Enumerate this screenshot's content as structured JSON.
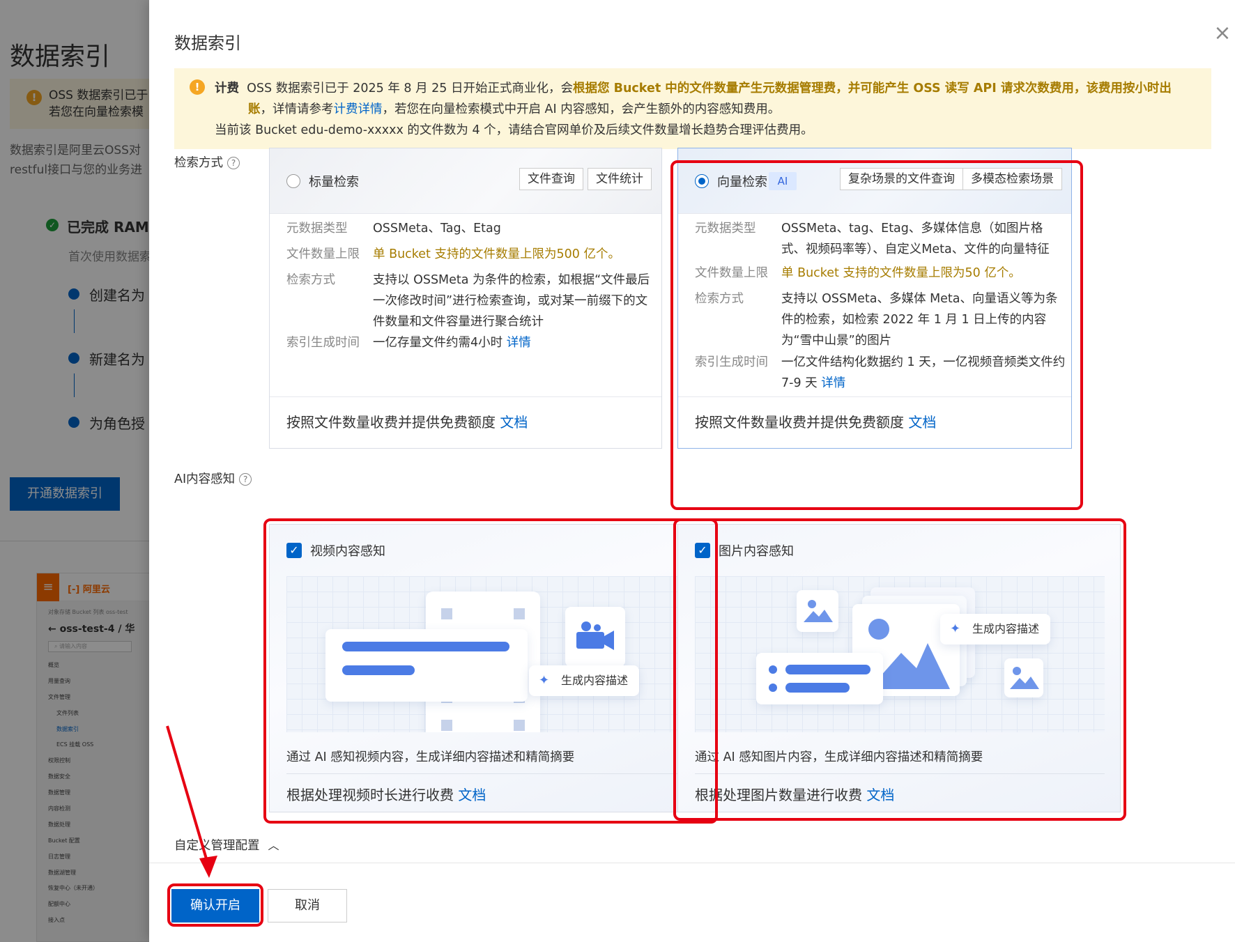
{
  "background": {
    "title": "数据索引",
    "notice_line1": "OSS 数据索引已于",
    "notice_line2": "若您在向量检索模",
    "desc_line1": "数据索引是阿里云OSS对",
    "desc_line2": "restful接口与您的业务进",
    "step_done": "已完成 RAM",
    "step_done_sub": "首次使用数据索",
    "step1": "创建名为",
    "step2": "新建名为",
    "step3": "为角色授",
    "enable_button": "开通数据索引",
    "console": {
      "logo": "阿里云",
      "breadcrumb": "对象存储   Bucket 列表   oss-test",
      "bucket_name": "oss-test-4 / 华",
      "search_placeholder": "请输入内容",
      "nav": [
        "概览",
        "用量查询",
        "文件管理",
        "文件列表",
        "数据索引",
        "ECS 挂载 OSS",
        "权限控制",
        "数据安全",
        "数据管理",
        "内容检测",
        "数据处理",
        "Bucket 配置",
        "日志管理",
        "数据湖管理",
        "恢复中心（未开通）",
        "配额中心",
        "接入点"
      ]
    }
  },
  "drawer": {
    "title": "数据索引",
    "alert": {
      "label": "计费",
      "line1_prefix": "OSS 数据索引已于 2025 年 8 月 25 日开始正式商业化，会",
      "line1_highlight": "根据您 Bucket 中的文件数量产生元数据管理费，并可能产生 OSS 读写 API 请求次数费用，该费用按小时出",
      "line2_highlight": "账",
      "line2_mid": "，详情请参考",
      "line2_link": "计费详情",
      "line2_suffix": "，若您在向量检索模式中开启 AI 内容感知，会产生额外的内容感知费用。",
      "line3": "当前该 Bucket edu-demo-xxxxx 的文件数为 4 个，请结合官网单价及后续文件数量增长趋势合理评估费用。"
    },
    "search_mode_label": "检索方式",
    "scalar": {
      "title": "标量检索",
      "selected": false,
      "tags": [
        "文件查询",
        "文件统计"
      ],
      "meta_key": "元数据类型",
      "meta_val": "OSSMeta、Tag、Etag",
      "limit_key": "文件数量上限",
      "limit_val": "单 Bucket 支持的文件数量上限为500 亿个。",
      "mode_key": "检索方式",
      "mode_val": "支持以 OSSMeta 为条件的检索，如根据“文件最后一次修改时间”进行检索查询，或对某一前缀下的文件数量和文件容量进行聚合统计",
      "time_key": "索引生成时间",
      "time_val": "一亿存量文件约需4小时",
      "time_link": "详情",
      "footer": "按照文件数量收费并提供免费额度",
      "footer_link": "文档"
    },
    "vector": {
      "title": "向量检索",
      "ai_tag": "AI",
      "selected": true,
      "tags": [
        "复杂场景的文件查询",
        "多模态检索场景"
      ],
      "meta_key": "元数据类型",
      "meta_val": "OSSMeta、tag、Etag、多媒体信息（如图片格式、视频码率等）、自定义Meta、文件的向量特征",
      "limit_key": "文件数量上限",
      "limit_val": "单 Bucket 支持的文件数量上限为50 亿个。",
      "mode_key": "检索方式",
      "mode_val": "支持以 OSSMeta、多媒体 Meta、向量语义等为条件的检索，如检索 2022 年 1 月 1 日上传的内容为“雪中山景”的图片",
      "time_key": "索引生成时间",
      "time_val": "一亿文件结构化数据约 1 天，一亿视频音频类文件约 7-9 天",
      "time_link": "详情",
      "footer": "按照文件数量收费并提供免费额度",
      "footer_link": "文档"
    },
    "ai_label": "AI内容感知",
    "video": {
      "title": "视频内容感知",
      "checked": true,
      "bubble": "生成内容描述",
      "desc": "通过 AI 感知视频内容，生成详细内容描述和精简摘要",
      "footer": "根据处理视频时长进行收费",
      "footer_link": "文档"
    },
    "image": {
      "title": "图片内容感知",
      "checked": true,
      "bubble": "生成内容描述",
      "desc": "通过 AI 感知图片内容，生成详细内容描述和精简摘要",
      "footer": "根据处理图片数量进行收费",
      "footer_link": "文档"
    },
    "custom_config": "自定义管理配置",
    "confirm_button": "确认开启",
    "cancel_button": "取消"
  },
  "colors": {
    "primary": "#0064c8",
    "warning_text": "#a67c00",
    "alert_bg": "#fdf6da",
    "annotation_red": "#e60012"
  }
}
